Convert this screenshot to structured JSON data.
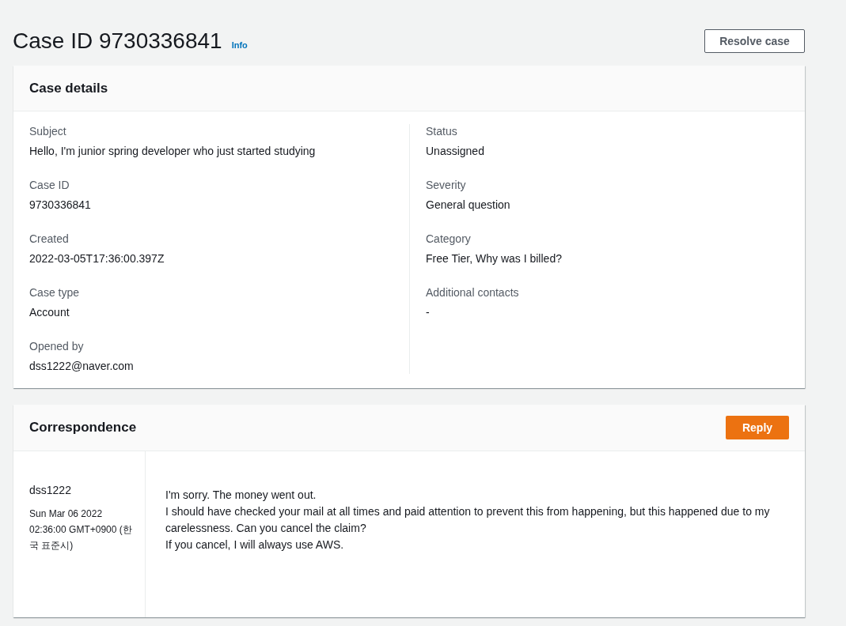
{
  "header": {
    "title": "Case ID 9730336841",
    "info_link": "Info",
    "action": "Resolve case"
  },
  "case_details": {
    "title": "Case details",
    "left": [
      {
        "label": "Subject",
        "value": "Hello, I'm junior spring developer who just started studying"
      },
      {
        "label": "Case ID",
        "value": "9730336841"
      },
      {
        "label": "Created",
        "value": "2022-03-05T17:36:00.397Z"
      },
      {
        "label": "Case type",
        "value": "Account"
      },
      {
        "label": "Opened by",
        "value": "dss1222@naver.com"
      }
    ],
    "right": [
      {
        "label": "Status",
        "value": "Unassigned"
      },
      {
        "label": "Severity",
        "value": "General question"
      },
      {
        "label": "Category",
        "value": "Free Tier, Why was I billed?"
      },
      {
        "label": "Additional contacts",
        "value": "-"
      }
    ]
  },
  "correspondence": {
    "title": "Correspondence",
    "reply_button": "Reply",
    "messages": [
      {
        "author": "dss1222",
        "date": "Sun Mar 06 2022 02:36:00 GMT+0900 (한국 표준시)",
        "lines": [
          "I'm sorry. The money went out.",
          "I should have checked your mail at all times and paid attention to prevent this from happening, but this happened due to my carelessness. Can you cancel the claim?",
          "If you cancel, I will always use AWS."
        ]
      }
    ]
  }
}
